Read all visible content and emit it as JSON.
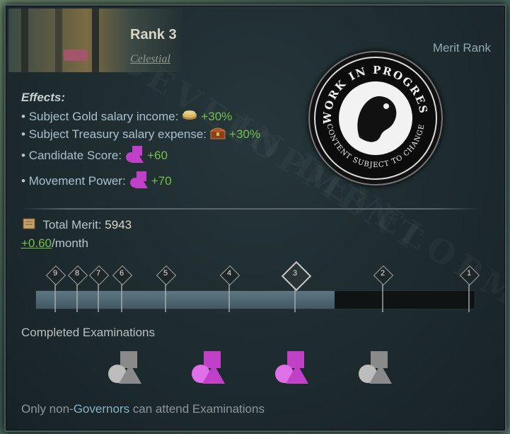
{
  "rank": {
    "title": "Rank 3",
    "subtitle": "Celestial",
    "label": "Merit Rank"
  },
  "wip_badge": {
    "top_text": "WORK IN PROGRESS",
    "bottom_text": "CONTENT SUBJECT TO CHANGE"
  },
  "watermark_text": "IN DEVELOPMENT",
  "effects": {
    "heading": "Effects:",
    "items": [
      {
        "label": "Subject Gold salary income:",
        "icon": "gold-coins-icon",
        "value": "+30%"
      },
      {
        "label": "Subject Treasury salary expense:",
        "icon": "treasure-chest-icon",
        "value": "+30%"
      },
      {
        "label": "Candidate Score:",
        "icon": "shapes-icon",
        "value": "+60"
      },
      {
        "label": "Movement Power:",
        "icon": "shapes-icon",
        "value": "+70"
      }
    ]
  },
  "merit": {
    "label": "Total Merit:",
    "value": "5943",
    "rate": "+0.60",
    "rate_unit": "/month"
  },
  "progress": {
    "markers": [
      "9",
      "8",
      "7",
      "6",
      "5",
      "4",
      "3",
      "2",
      "1"
    ],
    "current": "3",
    "fill_fraction": 0.68
  },
  "examinations": {
    "title": "Completed Examinations",
    "items": [
      {
        "completed": false
      },
      {
        "completed": true
      },
      {
        "completed": true
      },
      {
        "completed": false
      }
    ]
  },
  "footer": {
    "prefix": "Only non-",
    "highlight": "Governors",
    "suffix": " can attend Examinations"
  },
  "colors": {
    "green": "#74c14a",
    "magenta": "#c040c8",
    "grey_shape": "#8a8a8a"
  }
}
